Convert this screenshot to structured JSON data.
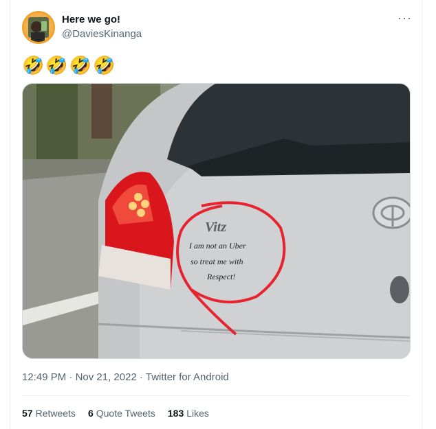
{
  "tweet": {
    "display_name": "Here we go!",
    "handle": "@DaviesKinanga",
    "more_label": "···",
    "text": "🤣🤣🤣🤣",
    "time": "12:49 PM",
    "date": "Nov 21, 2022",
    "source": "Twitter for Android",
    "separator": " · "
  },
  "image": {
    "badge_text": "Vitz",
    "sticker_lines": [
      "I am not an Uber",
      "so treat me with",
      "Respect!"
    ],
    "colors": {
      "car": "#c9cbcd",
      "circle": "#e6232e",
      "taillight": "#d9161b"
    }
  },
  "stats": {
    "retweets": {
      "count": "57",
      "label": "Retweets"
    },
    "quotes": {
      "count": "6",
      "label": "Quote Tweets"
    },
    "likes": {
      "count": "183",
      "label": "Likes"
    }
  }
}
